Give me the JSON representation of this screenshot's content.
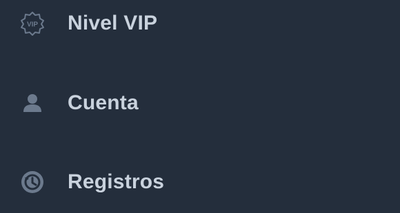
{
  "colors": {
    "background": "#242e3c",
    "label": "#c9d2dd",
    "icon": "#6c7a8d"
  },
  "menu": {
    "items": [
      {
        "label": "Nivel VIP",
        "icon": "vip-badge-icon"
      },
      {
        "label": "Cuenta",
        "icon": "user-icon"
      },
      {
        "label": "Registros",
        "icon": "history-clock-icon"
      }
    ]
  }
}
